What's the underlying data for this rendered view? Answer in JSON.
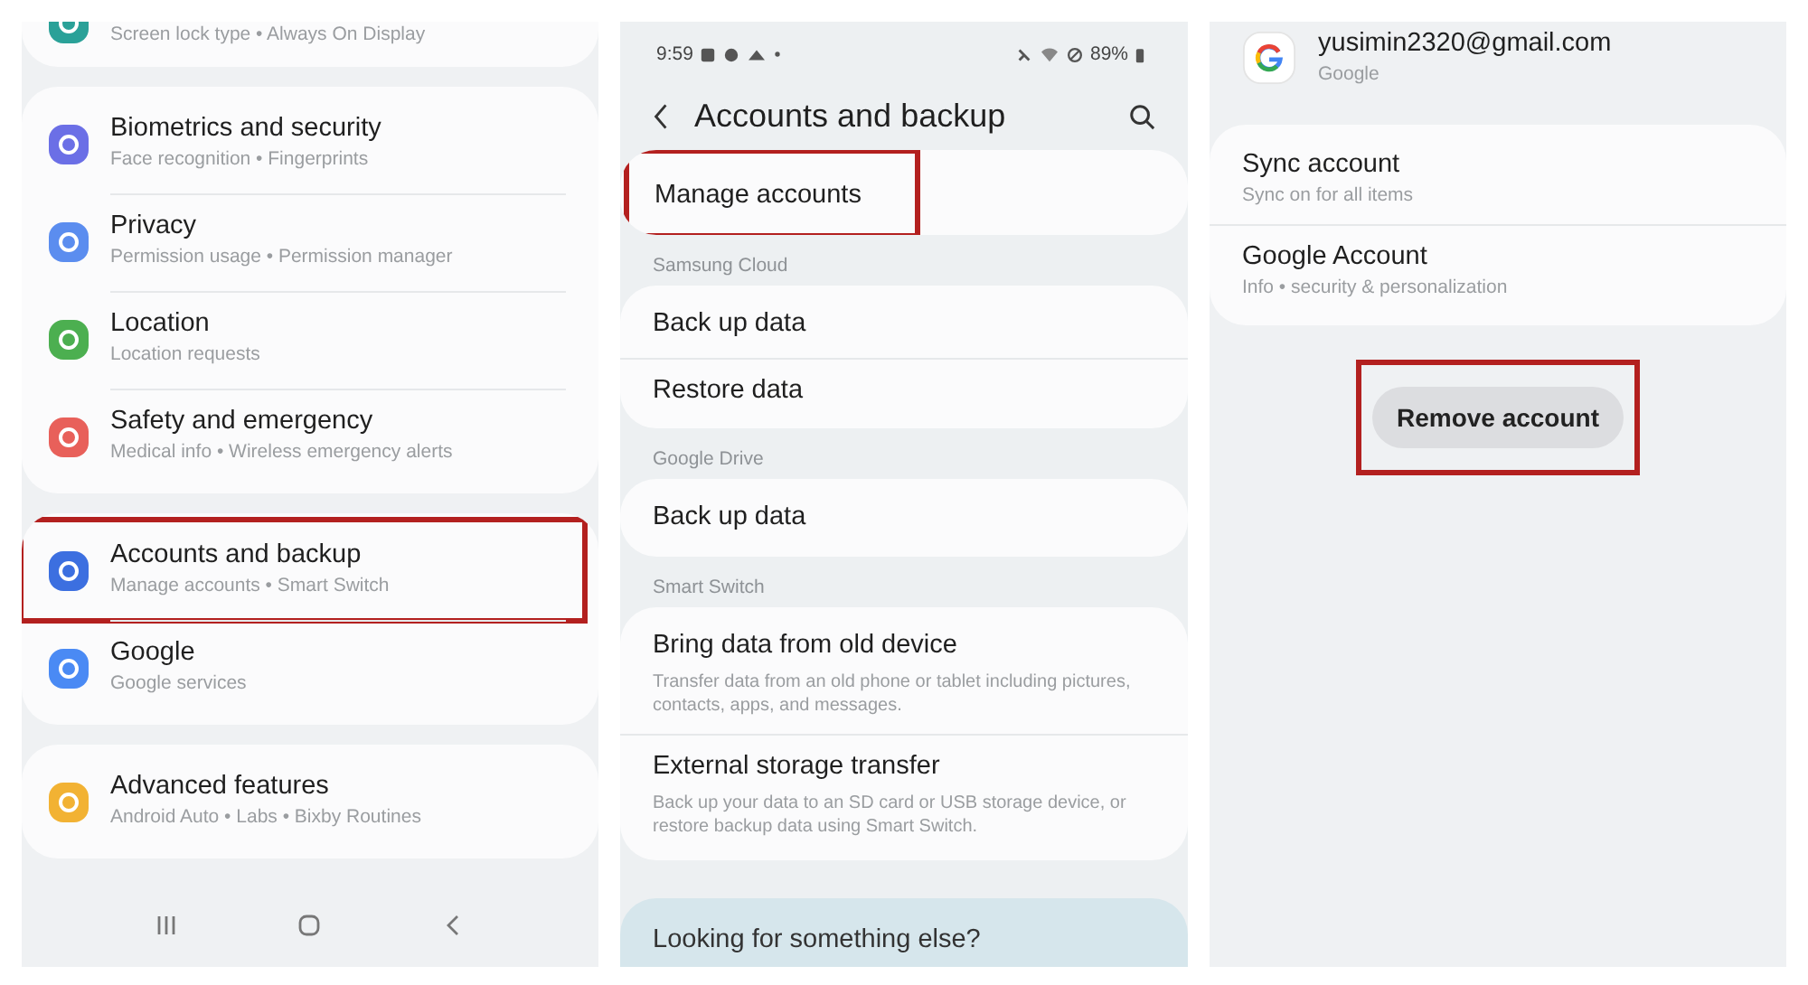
{
  "panels": [
    {
      "sections": [
        {
          "kind": "card",
          "clipped": true,
          "rows": [
            {
              "subtitle": "Screen lock type • Always On Display",
              "color": "#2aa198"
            }
          ]
        },
        {
          "kind": "card",
          "rows": [
            {
              "title": "Biometrics and security",
              "subtitle": "Face recognition • Fingerprints",
              "color": "#6b6fe6"
            },
            {
              "title": "Privacy",
              "subtitle": "Permission usage • Permission manager",
              "color": "#5b8def"
            },
            {
              "title": "Location",
              "subtitle": "Location requests",
              "color": "#4caf50"
            },
            {
              "title": "Safety and emergency",
              "subtitle": "Medical info • Wireless emergency alerts",
              "color": "#e8605a"
            }
          ]
        },
        {
          "kind": "card",
          "rows": [
            {
              "title": "Accounts and backup",
              "subtitle": "Manage accounts • Smart Switch",
              "color": "#3c6fe0",
              "highlighted": true
            },
            {
              "title": "Google",
              "subtitle": "Google services",
              "color": "#4a8af4"
            }
          ]
        },
        {
          "kind": "card",
          "rows": [
            {
              "title": "Advanced features",
              "subtitle": "Android Auto • Labs • Bixby Routines",
              "color": "#f2b233"
            }
          ]
        },
        {
          "kind": "nav"
        }
      ]
    },
    {
      "sections": [
        {
          "kind": "status",
          "time": "9:59",
          "battery": "89%"
        },
        {
          "kind": "header",
          "title": "Accounts and backup"
        },
        {
          "kind": "card",
          "rows": [
            {
              "title": "Manage accounts",
              "highlighted": true
            }
          ]
        },
        {
          "kind": "label",
          "text": "Samsung Cloud"
        },
        {
          "kind": "card",
          "rows": [
            {
              "title": "Back up data"
            },
            {
              "title": "Restore data"
            }
          ]
        },
        {
          "kind": "label",
          "text": "Google Drive"
        },
        {
          "kind": "card",
          "rows": [
            {
              "title": "Back up data"
            }
          ]
        },
        {
          "kind": "label",
          "text": "Smart Switch"
        },
        {
          "kind": "card",
          "rows": [
            {
              "title": "Bring data from old device",
              "subtitle": "Transfer data from an old phone or tablet including pictures, contacts, apps, and messages."
            },
            {
              "title": "External storage transfer",
              "subtitle": "Back up your data to an SD card or USB storage device, or restore backup data using Smart Switch."
            }
          ]
        },
        {
          "kind": "more",
          "title": "Looking for something else?"
        }
      ]
    },
    {
      "sections": [
        {
          "kind": "account",
          "email": "yusimin2320@gmail.com",
          "provider": "Google"
        },
        {
          "kind": "card",
          "rows": [
            {
              "title": "Sync account",
              "subtitle": "Sync on for all items"
            },
            {
              "title": "Google Account",
              "subtitle": "Info • security & personalization"
            }
          ]
        },
        {
          "kind": "button",
          "label": "Remove account",
          "highlighted": true
        }
      ]
    }
  ]
}
